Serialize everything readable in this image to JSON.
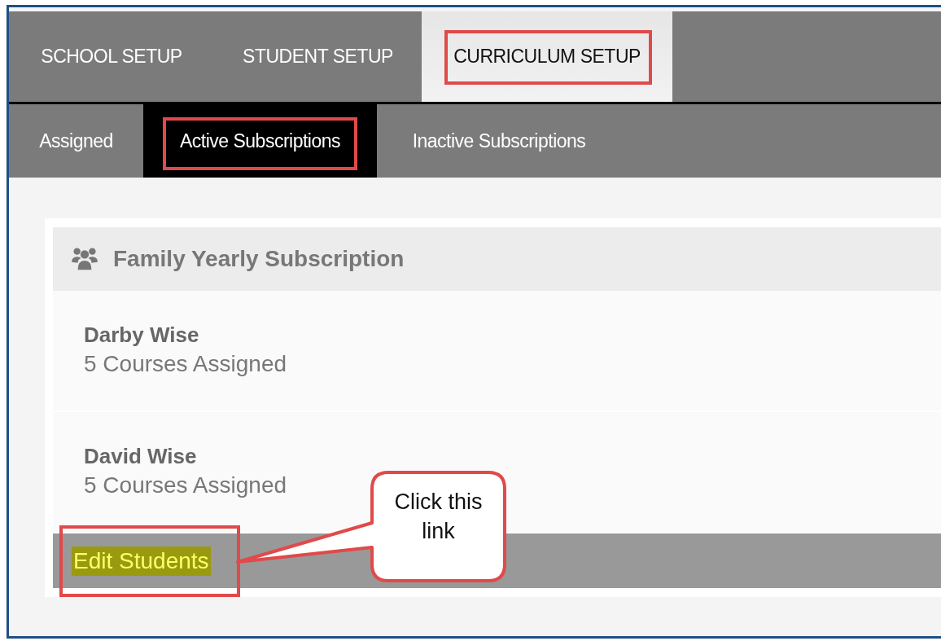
{
  "top_tabs": [
    {
      "label": "SCHOOL SETUP",
      "selected": false,
      "annotated": false
    },
    {
      "label": "STUDENT SETUP",
      "selected": false,
      "annotated": false
    },
    {
      "label": "CURRICULUM SETUP",
      "selected": true,
      "annotated": true
    }
  ],
  "sub_tabs": [
    {
      "label": "Assigned",
      "selected": false,
      "annotated": false
    },
    {
      "label": "Active Subscriptions",
      "selected": true,
      "annotated": true
    },
    {
      "label": "Inactive Subscriptions",
      "selected": false,
      "annotated": false
    }
  ],
  "subscription": {
    "title": "Family Yearly Subscription",
    "students": [
      {
        "name": "Darby Wise",
        "detail": "5 Courses Assigned"
      },
      {
        "name": "David Wise",
        "detail": "5 Courses Assigned"
      }
    ],
    "link": {
      "label": "Edit Students",
      "highlighted": true,
      "annotated": true
    }
  },
  "callout": {
    "text": "Click this link"
  }
}
